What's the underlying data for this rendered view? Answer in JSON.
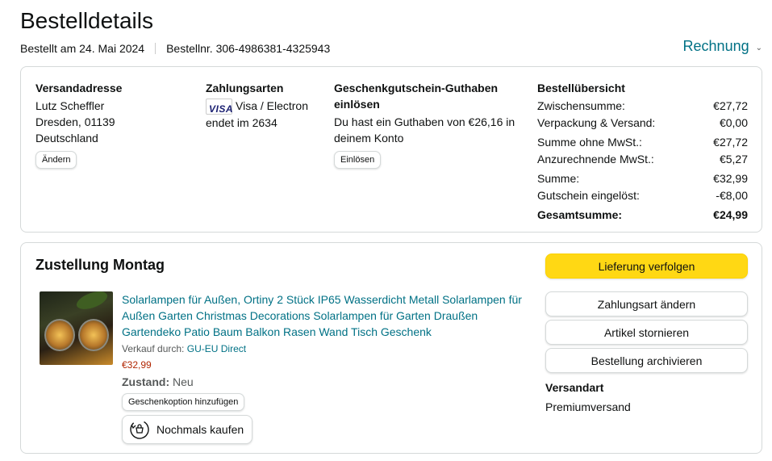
{
  "header": {
    "title": "Bestelldetails",
    "ordered_on": "Bestellt am 24. Mai 2024",
    "order_number": "Bestellnr. 306-4986381-4325943",
    "invoice_label": "Rechnung"
  },
  "address": {
    "heading": "Versandadresse",
    "name": "Lutz Scheffler",
    "city": "Dresden, 01139",
    "country": "Deutschland",
    "change_label": "Ändern"
  },
  "payment": {
    "heading": "Zahlungsarten",
    "card_logo": "VISA",
    "card_type": "Visa / Electron",
    "card_ending": "endet im 2634"
  },
  "gift": {
    "heading": "Geschenkgutschein-Guthaben einlösen",
    "balance_text": "Du hast ein Guthaben von €26,16 in deinem Konto",
    "redeem_label": "Einlösen"
  },
  "summary": {
    "heading": "Bestellübersicht",
    "rows": [
      {
        "label": "Zwischensumme:",
        "value": "€27,72"
      },
      {
        "label": "Verpackung & Versand:",
        "value": "€0,00"
      },
      {
        "label": "Summe ohne MwSt.:",
        "value": "€27,72"
      },
      {
        "label": "Anzurechnende MwSt.:",
        "value": "€5,27"
      },
      {
        "label": "Summe:",
        "value": "€32,99"
      },
      {
        "label": "Gutschein eingelöst:",
        "value": "-€8,00"
      }
    ],
    "total_label": "Gesamtsumme:",
    "total_value": "€24,99"
  },
  "delivery": {
    "title": "Zustellung Montag",
    "product": {
      "title": "Solarlampen für Außen, Ortiny 2 Stück IP65 Wasserdicht Metall Solarlampen für Außen Garten Christmas Decorations Solarlampen für Garten Draußen Gartendeko Patio Baum Balkon Rasen Wand Tisch Geschenk",
      "seller_prefix": "Verkauf durch:",
      "seller": "GU-EU Direct",
      "price": "€32,99",
      "condition_label": "Zustand:",
      "condition": "Neu",
      "gift_option_label": "Geschenkoption hinzufügen",
      "rebuy_label": "Nochmals kaufen"
    },
    "actions": {
      "track": "Lieferung verfolgen",
      "change_payment": "Zahlungsart ändern",
      "cancel": "Artikel stornieren",
      "archive": "Bestellung archivieren"
    },
    "shipping_label": "Versandart",
    "shipping_value": "Premiumversand"
  },
  "colors": {
    "link": "#007185",
    "price": "#b12704",
    "primary_button": "#ffd814",
    "border": "#d5d9d9"
  }
}
